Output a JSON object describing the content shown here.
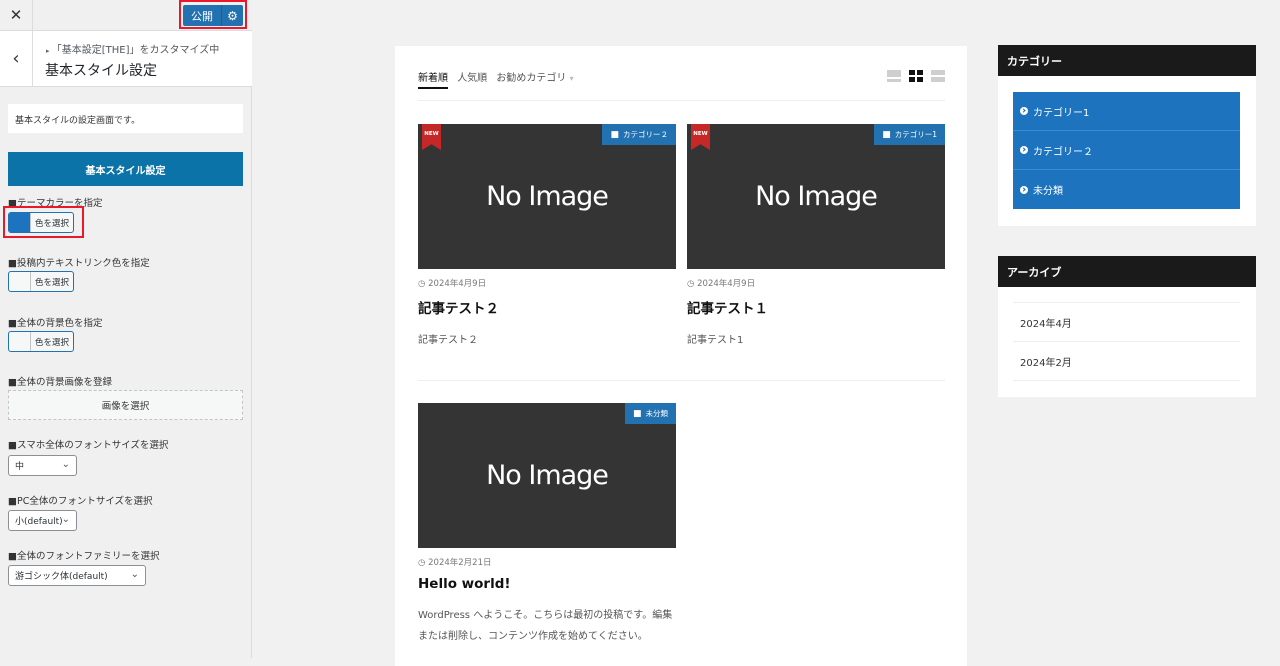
{
  "customizer": {
    "close_label": "✕",
    "publish_label": "公開",
    "gear_icon": "⚙",
    "back_icon": "‹",
    "breadcrumb": "「基本設定[THE]」をカスタマイズ中",
    "section_title": "基本スタイル設定",
    "description": "基本スタイルの設定画面です。",
    "banner": "基本スタイル設定",
    "controls": {
      "theme_color_label": "■テーマカラーを指定",
      "theme_color_button": "色を選択",
      "theme_color_value": "#1e73be",
      "link_color_label": "■投稿内テキストリンク色を指定",
      "link_color_button": "色を選択",
      "bg_color_label": "■全体の背景色を指定",
      "bg_color_button": "色を選択",
      "bg_image_label": "■全体の背景画像を登録",
      "bg_image_button": "画像を選択",
      "sp_font_size_label": "■スマホ全体のフォントサイズを選択",
      "sp_font_size_value": "中",
      "pc_font_size_label": "■PC全体のフォントサイズを選択",
      "pc_font_size_value": "小(default)",
      "font_family_label": "■全体のフォントファミリーを選択",
      "font_family_value": "游ゴシック体(default)"
    }
  },
  "preview": {
    "tabs": [
      {
        "label": "新着順"
      },
      {
        "label": "人気順"
      },
      {
        "label": "お勧めカテゴリ"
      }
    ],
    "tab_arrow": "▾",
    "posts": [
      {
        "no_image": "No Image",
        "new_badge": "NEW",
        "category": "カテゴリー２",
        "date": "2024年4月9日",
        "title": "記事テスト２",
        "excerpt": "記事テスト２"
      },
      {
        "no_image": "No Image",
        "new_badge": "NEW",
        "category": "カテゴリー1",
        "date": "2024年4月9日",
        "title": "記事テスト１",
        "excerpt": "記事テスト1"
      },
      {
        "no_image": "No Image",
        "category": "未分類",
        "date": "2024年2月21日",
        "title": "Hello world!",
        "excerpt": "WordPress へようこそ。こちらは最初の投稿です。編集または削除し、コンテンツ作成を始めてください。"
      }
    ],
    "widgets": {
      "categories": {
        "title": "カテゴリー",
        "items": [
          "カテゴリー1",
          "カテゴリー２",
          "未分類"
        ]
      },
      "archives": {
        "title": "アーカイブ",
        "items": [
          "2024年4月",
          "2024年2月"
        ]
      }
    }
  }
}
